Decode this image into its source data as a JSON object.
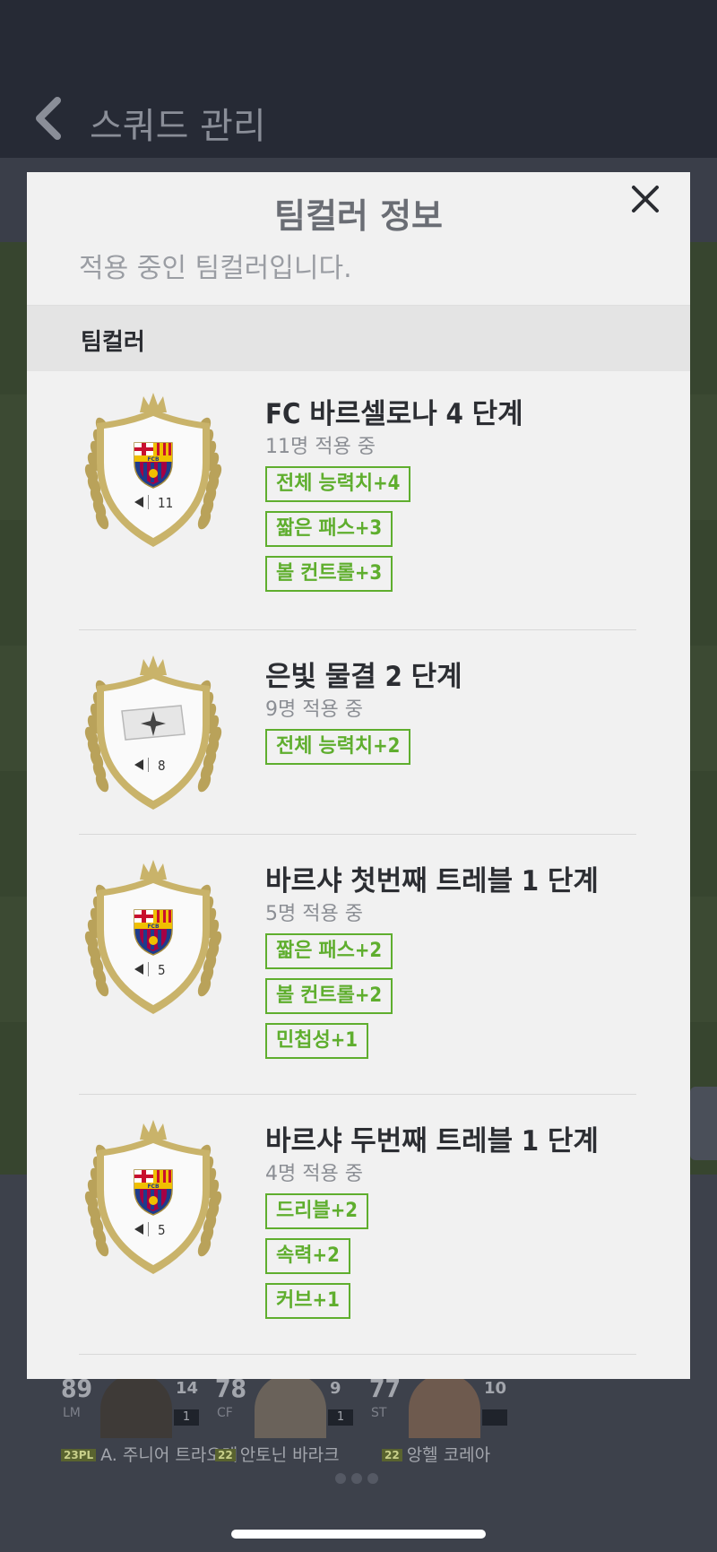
{
  "background": {
    "title": "스쿼드 관리",
    "players": [
      {
        "ovr": "89",
        "pos": "LM",
        "num": "14",
        "lvl": "1",
        "badge": "23PL",
        "name": "A. 주니어 트라오레"
      },
      {
        "ovr": "78",
        "pos": "CF",
        "num": "9",
        "lvl": "1",
        "badge": "22",
        "name": "안토닌 바라크"
      },
      {
        "ovr": "77",
        "pos": "ST",
        "num": "10",
        "lvl": "",
        "badge": "22",
        "name": "앙헬 코레아"
      }
    ]
  },
  "modal": {
    "title": "팀컬러 정보",
    "subtitle": "적용 중인 팀컬러입니다.",
    "section_label": "팀컬러",
    "items": [
      {
        "name": "FC 바르셀로나 4 단계",
        "count": "11명 적용 중",
        "crest_number": "11",
        "crest_type": "fcb-crest",
        "tags": [
          "전체 능력치+4",
          "짧은 패스+3",
          "볼 컨트롤+3"
        ]
      },
      {
        "name": "은빛 물결 2 단계",
        "count": "9명 적용 중",
        "crest_number": "8",
        "crest_type": "silver-star-crest",
        "tags": [
          "전체 능력치+2"
        ]
      },
      {
        "name": "바르샤 첫번째 트레블 1 단계",
        "count": "5명 적용 중",
        "crest_number": "5",
        "crest_type": "fcb-crest",
        "tags": [
          "짧은 패스+2",
          "볼 컨트롤+2",
          "민첩성+1"
        ]
      },
      {
        "name": "바르샤 두번째 트레블 1 단계",
        "count": "4명 적용 중",
        "crest_number": "5",
        "crest_type": "fcb-crest",
        "tags": [
          "드리블+2",
          "속력+2",
          "커브+1"
        ]
      }
    ]
  },
  "colors": {
    "tag_green": "#5fae2e",
    "gold": "#c9b36a"
  }
}
